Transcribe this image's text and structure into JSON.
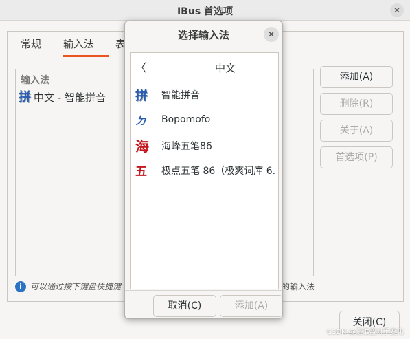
{
  "window": {
    "title": "IBus 首选项",
    "close_glyph": "✕"
  },
  "tabs": [
    {
      "label": "常规"
    },
    {
      "label": "输入法"
    },
    {
      "label": "表"
    }
  ],
  "list": {
    "header": "输入法",
    "rows": [
      {
        "icon": "pinyin-icon",
        "icon_glyph": "拼",
        "label": "中文 - 智能拼音"
      }
    ]
  },
  "side_buttons": {
    "add": "添加(A)",
    "remove": "删除(R)",
    "about": "关于(A)",
    "prefs": "首选项(P)"
  },
  "hint": {
    "info_glyph": "i",
    "text": "可以通过按下键盘快捷键",
    "tail": "的输入法"
  },
  "close_button": "关闭(C)",
  "watermark": "CSDN @是谁盗对手变化",
  "dialog": {
    "title": "选择输入法",
    "close_glyph": "✕",
    "back_glyph": "〈",
    "header": "中文",
    "items": [
      {
        "icon": "pinyin-icon",
        "glyph": "拼",
        "label": "智能拼音"
      },
      {
        "icon": "bopomofo-icon",
        "glyph": "ㄉ",
        "label": "Bopomofo"
      },
      {
        "icon": "haifeng-icon",
        "glyph": "海",
        "label": "海峰五笔86"
      },
      {
        "icon": "jidian-icon",
        "glyph": "五",
        "label": "极点五笔 86（极爽词库 6."
      }
    ],
    "cancel": "取消(C)",
    "add": "添加(A)"
  },
  "colors": {
    "accent": "#e95420",
    "link_blue": "#2c73c4",
    "ime_red": "#c4161c",
    "ime_blue": "#2a5db0"
  }
}
